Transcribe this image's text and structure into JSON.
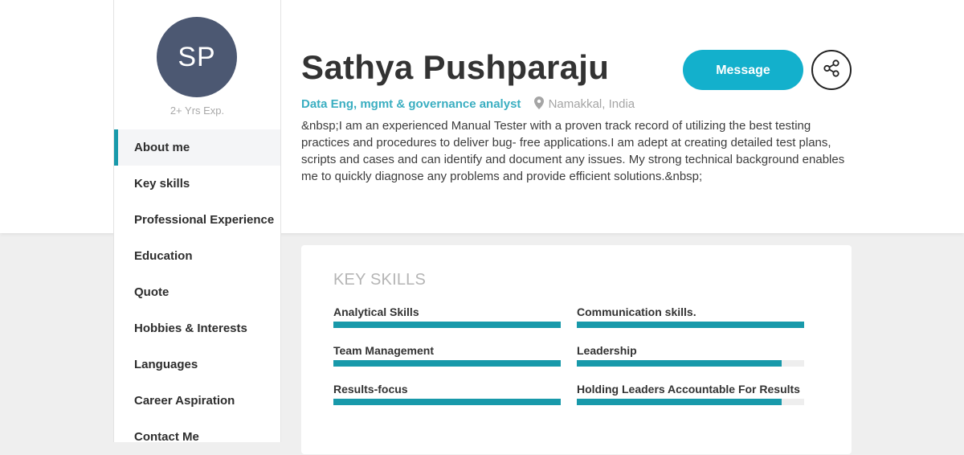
{
  "profile": {
    "initials": "SP",
    "experience": "2+ Yrs Exp.",
    "name": "Sathya Pushparaju",
    "role": "Data Eng, mgmt & governance analyst",
    "location": "Namakkal, India",
    "about": "&nbsp;I am an experienced Manual Tester with a proven track record of utilizing the best testing practices and procedures to deliver bug- free applications.I am adept at creating detailed test plans, scripts and cases and can identify and document any issues. My strong technical background enables me to quickly diagnose any problems and provide efficient solutions.&nbsp;",
    "avatar_color": "#4c5872"
  },
  "actions": {
    "message_label": "Message",
    "share_icon": "share-icon",
    "accent_color": "#13b0cc"
  },
  "sidebar": {
    "items": [
      {
        "label": "About me",
        "active": true
      },
      {
        "label": "Key skills",
        "active": false
      },
      {
        "label": "Professional Experience",
        "active": false
      },
      {
        "label": "Education",
        "active": false
      },
      {
        "label": "Quote",
        "active": false
      },
      {
        "label": "Hobbies & Interests",
        "active": false
      },
      {
        "label": "Languages",
        "active": false
      },
      {
        "label": "Career Aspiration",
        "active": false
      },
      {
        "label": "Contact Me",
        "active": false
      }
    ]
  },
  "skills": {
    "title": "KEY SKILLS",
    "bar_color": "#1899aa",
    "items": [
      {
        "name": "Analytical Skills",
        "level": 1.0
      },
      {
        "name": "Communication skills.",
        "level": 1.0
      },
      {
        "name": "Team Management",
        "level": 1.0
      },
      {
        "name": "Leadership",
        "level": 0.9
      },
      {
        "name": "Results-focus",
        "level": 1.0
      },
      {
        "name": "Holding Leaders Accountable For Results",
        "level": 0.9
      }
    ]
  }
}
